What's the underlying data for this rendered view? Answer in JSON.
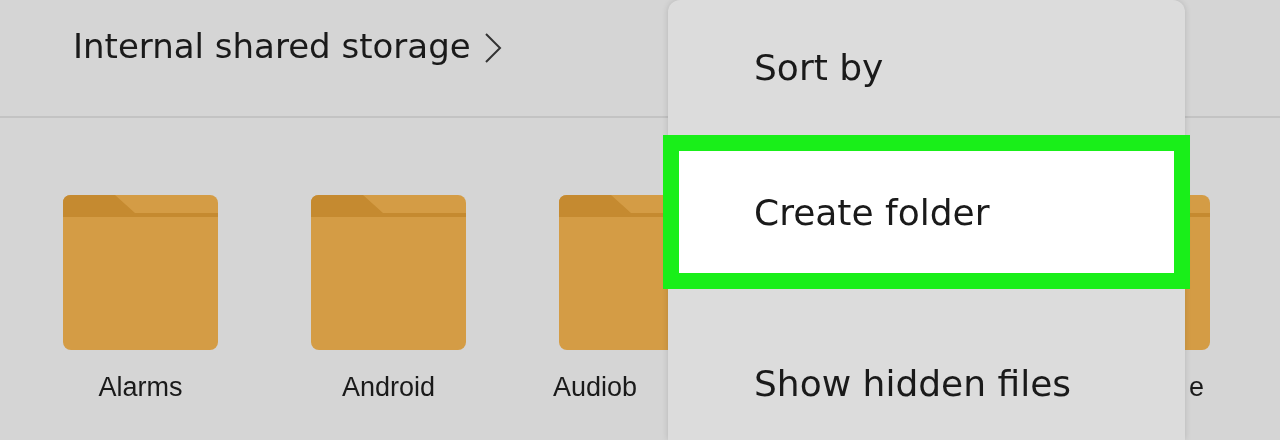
{
  "breadcrumb": {
    "label": "Internal shared storage"
  },
  "folders": [
    {
      "name": "Alarms"
    },
    {
      "name": "Android"
    },
    {
      "name": "Audiob"
    },
    {
      "name": "e"
    }
  ],
  "menu": {
    "items": [
      {
        "label": "Sort by",
        "highlighted": false
      },
      {
        "label": "Create folder",
        "highlighted": true
      },
      {
        "label": "Show hidden files",
        "highlighted": false
      }
    ]
  }
}
